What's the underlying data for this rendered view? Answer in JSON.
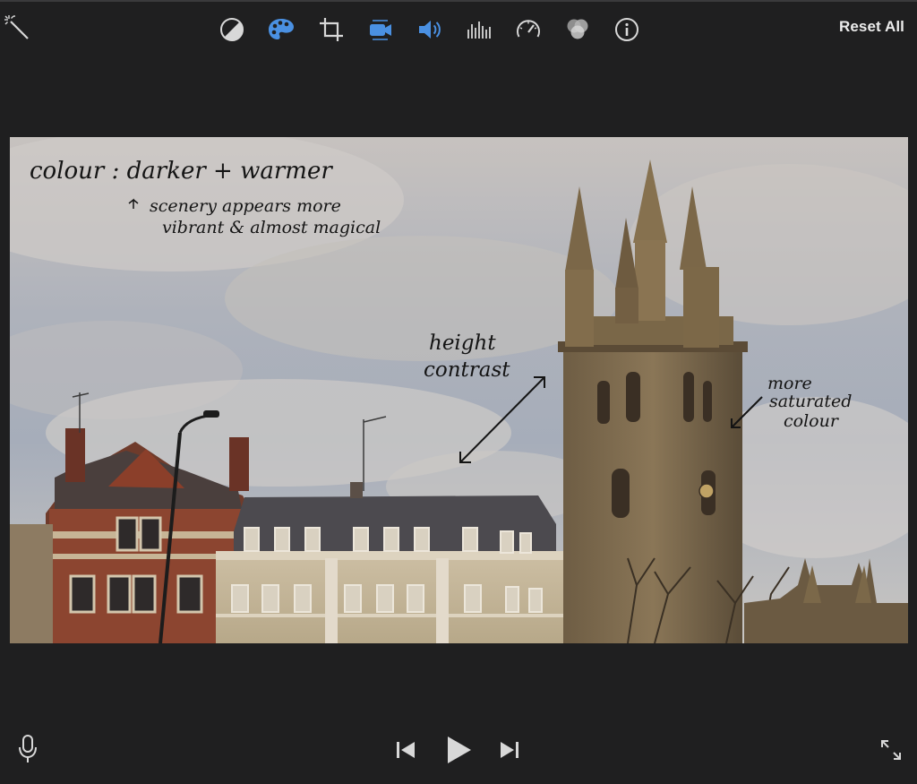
{
  "toolbar": {
    "reset_label": "Reset All",
    "icons": [
      "magic-wand-icon",
      "color-balance-icon",
      "color-correction-icon",
      "crop-icon",
      "stabilization-icon",
      "volume-icon",
      "equalizer-icon",
      "speed-icon",
      "clip-filter-icon",
      "info-icon"
    ],
    "active_icons": [
      "color-correction-icon",
      "stabilization-icon",
      "volume-icon"
    ]
  },
  "annotations": {
    "colour_title": "colour : darker + warmer",
    "scenery_line1": "scenery appears more",
    "scenery_line2": "vibrant & almost magical",
    "height_line1": "height",
    "height_line2": "contrast",
    "saturated_line1": "more",
    "saturated_line2": "saturated",
    "saturated_line3": "colour"
  },
  "playback": {
    "icons": [
      "microphone-icon",
      "skip-back-icon",
      "play-icon",
      "skip-forward-icon",
      "fullscreen-icon"
    ]
  },
  "colors": {
    "background": "#1f1f20",
    "accent_blue": "#4a90e2",
    "icon_gray": "#d8d8d8"
  }
}
